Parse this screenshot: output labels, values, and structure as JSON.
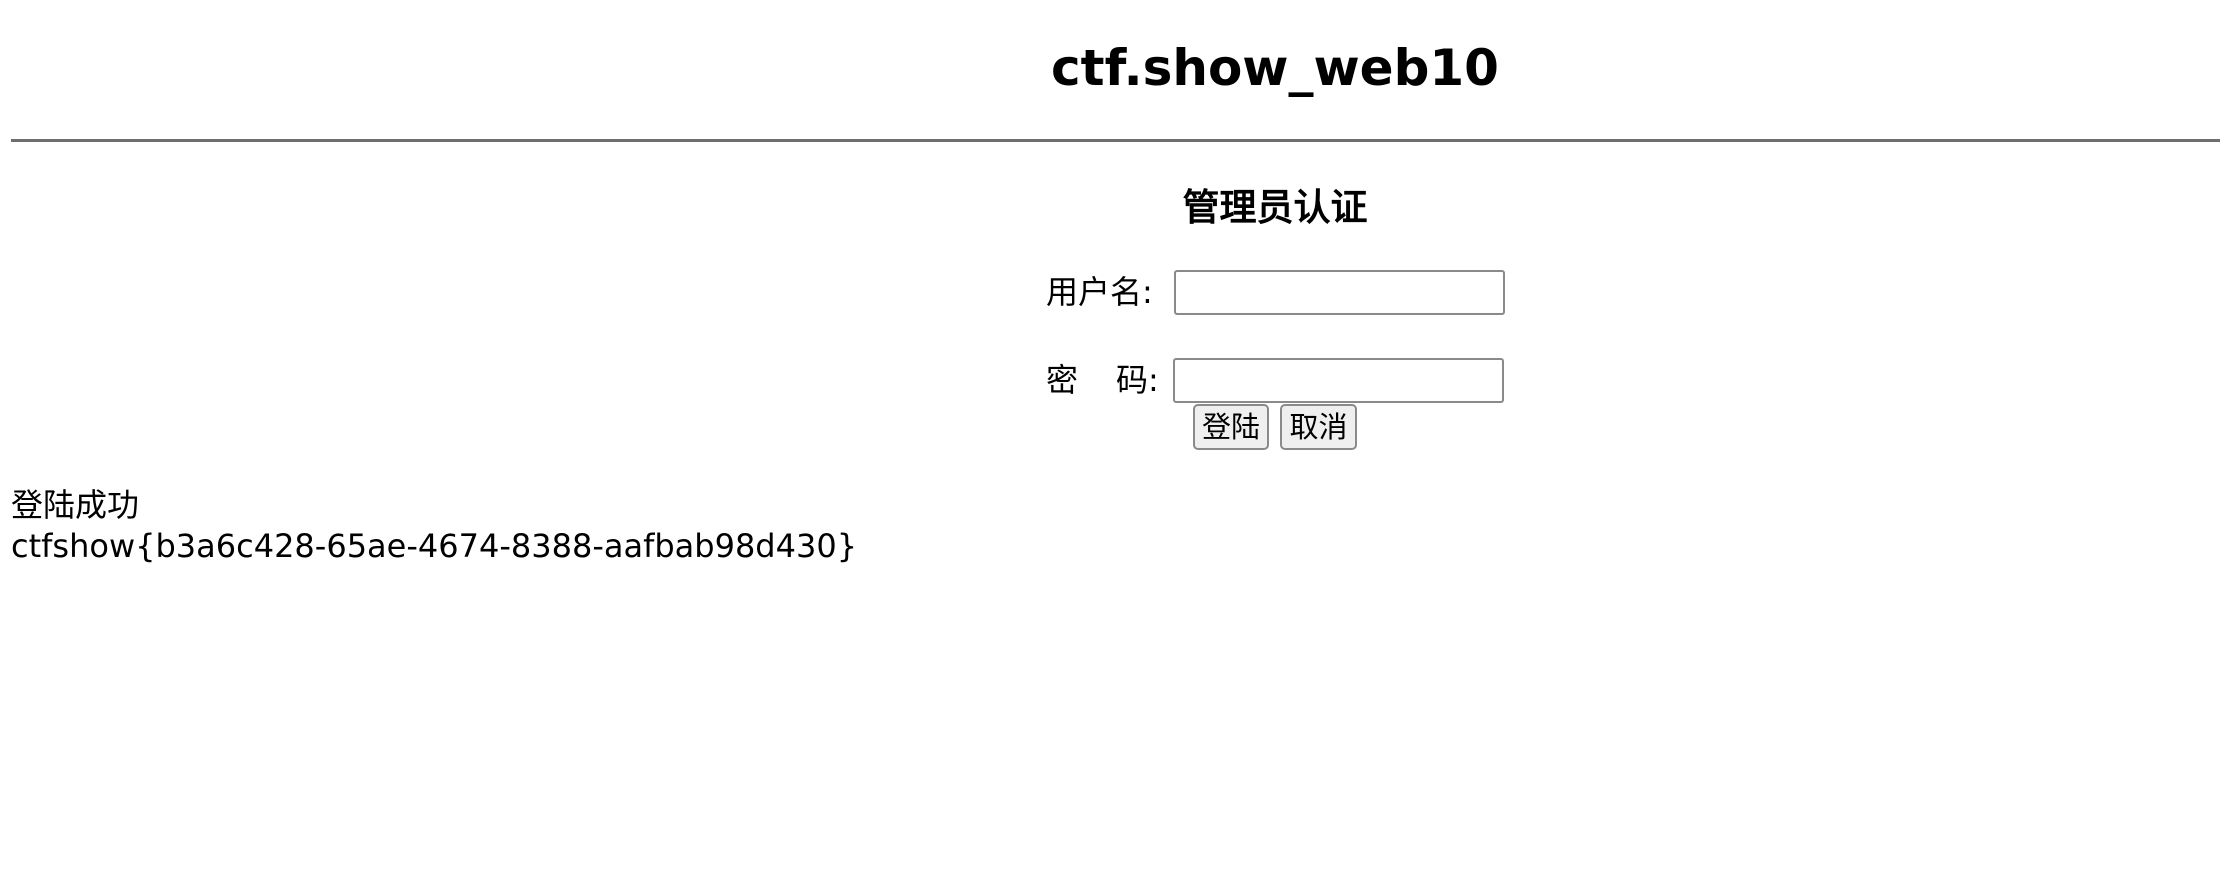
{
  "header": {
    "title": "ctf.show_web10"
  },
  "login_form": {
    "heading": "管理员认证",
    "username_label": "用户名:",
    "username_value": "",
    "password_label_first": "密",
    "password_label_second": "码:",
    "password_value": "",
    "login_button": "登陆",
    "cancel_button": "取消"
  },
  "result": {
    "status": "登陆成功",
    "flag": "ctfshow{b3a6c428-65ae-4674-8388-aafbab98d430}"
  },
  "colors": {
    "background": "#ffffff",
    "text": "#000000",
    "divider": "#6e6e6e",
    "button_background": "#efefef",
    "input_border": "#8a8a8a"
  }
}
